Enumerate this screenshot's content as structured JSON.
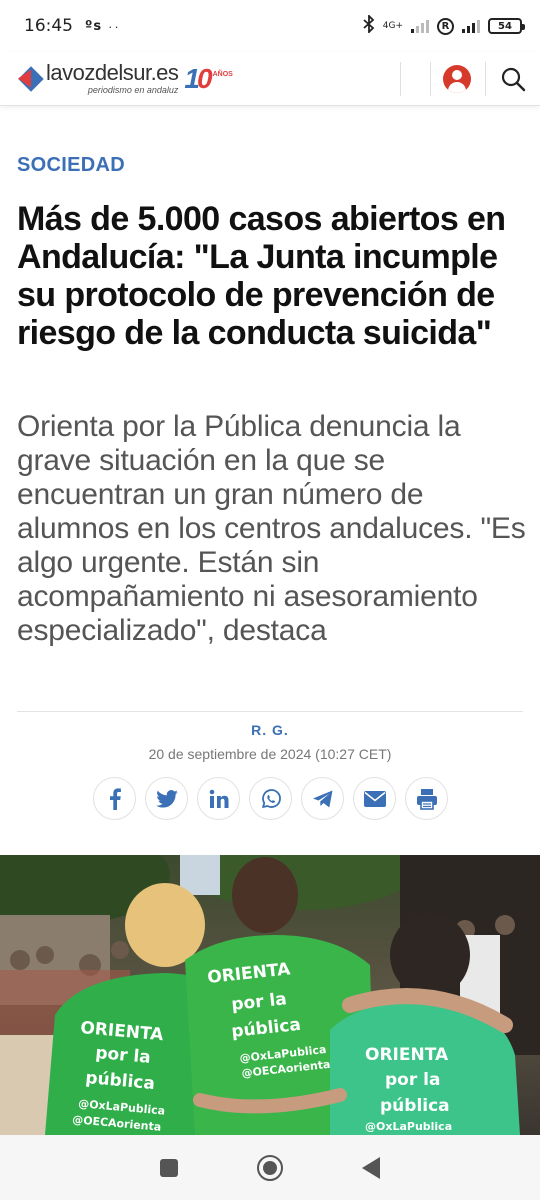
{
  "status_bar": {
    "time": "16:45",
    "extra": "ºs",
    "dots": "··",
    "network": "4G+",
    "r_badge": "R",
    "battery": "54"
  },
  "header": {
    "logo_name": "lavozdelsur.es",
    "logo_tagline": "periodismo en andaluz",
    "logo_anniversary_num": "10",
    "logo_anniversary_label": "AÑOS",
    "icons": [
      "user-icon",
      "search-icon"
    ]
  },
  "article": {
    "section": "SOCIEDAD",
    "headline": "Más de 5.000 casos abiertos en Andalucía: \"La Junta incumple su protocolo de prevención de riesgo de la conducta suicida\"",
    "subhead": "Orienta por la Pública denuncia la grave situación en la que se encuentran un gran número de alumnos en los centros andaluces. \"Es algo urgente. Están sin acompañamiento ni asesoramiento especializado\", destaca",
    "author": "R. G.",
    "date": "20 de septiembre de 2024 (10:27 CET)"
  },
  "share": {
    "buttons": [
      "facebook-icon",
      "twitter-icon",
      "linkedin-icon",
      "whatsapp-icon",
      "telegram-icon",
      "email-icon",
      "print-icon"
    ]
  },
  "photo": {
    "shirt_lines": [
      "ORIENTA",
      "por la",
      "pública",
      "@OxLaPublica",
      "@OECAorienta"
    ]
  },
  "colors": {
    "brand_blue": "#3b6fb6",
    "brand_red": "#e13d3d",
    "shirt_green": "#2fae4a"
  }
}
